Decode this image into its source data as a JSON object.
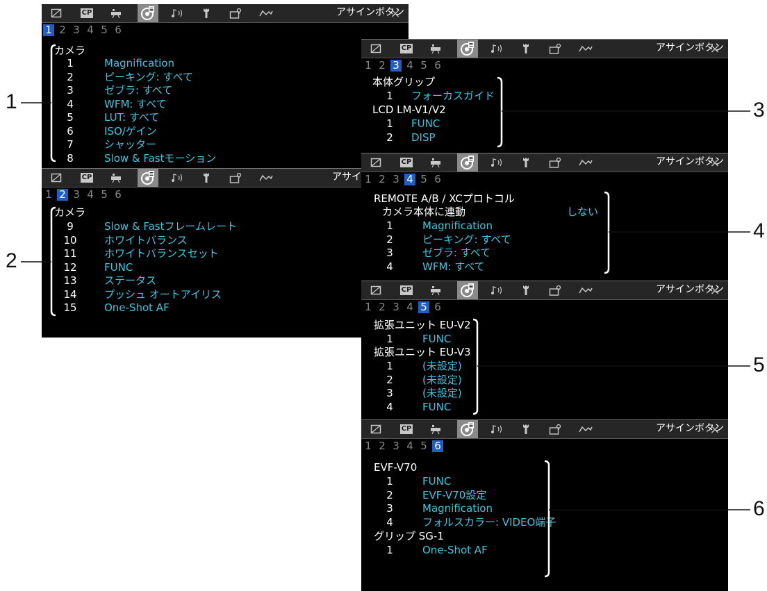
{
  "tabs": [
    {
      "icon": "photo-frame-icon"
    },
    {
      "icon": "cp-icon",
      "label": "CP"
    },
    {
      "icon": "camera-icon"
    },
    {
      "icon": "assign-button-icon"
    },
    {
      "icon": "audio-icon"
    },
    {
      "icon": "wrench-icon"
    },
    {
      "icon": "recording-media-icon"
    },
    {
      "icon": "signal-wave-icon"
    }
  ],
  "close_symbol": "×",
  "page_title": "アサインボタン",
  "page_numbers": [
    "1",
    "2",
    "3",
    "4",
    "5",
    "6"
  ],
  "panels": {
    "p1": {
      "active_page": "1",
      "header": "カメラ",
      "items": [
        {
          "num": "1",
          "value": "Magnification"
        },
        {
          "num": "2",
          "value": "ピーキング: すべて"
        },
        {
          "num": "3",
          "value": "ゼブラ: すべて"
        },
        {
          "num": "4",
          "value": "WFM: すべて"
        },
        {
          "num": "5",
          "value": "LUT: すべて"
        },
        {
          "num": "6",
          "value": "ISO/ゲイン"
        },
        {
          "num": "7",
          "value": "シャッター"
        },
        {
          "num": "8",
          "value": "Slow & Fastモーション"
        }
      ]
    },
    "p2": {
      "active_page": "2",
      "title_visible": "アサイ",
      "header": "カメラ",
      "items": [
        {
          "num": "9",
          "value": "Slow & Fastフレームレート"
        },
        {
          "num": "10",
          "value": "ホワイトバランス"
        },
        {
          "num": "11",
          "value": "ホワイトバランスセット"
        },
        {
          "num": "12",
          "value": "FUNC"
        },
        {
          "num": "13",
          "value": "ステータス"
        },
        {
          "num": "14",
          "value": "プッシュ オートアイリス"
        },
        {
          "num": "15",
          "value": "One-Shot AF"
        }
      ]
    },
    "p3": {
      "active_page": "3",
      "group1": "本体グリップ",
      "g1_items": [
        {
          "num": "1",
          "value": "フォーカスガイド"
        }
      ],
      "group2": "LCD LM-V1/V2",
      "g2_items": [
        {
          "num": "1",
          "value": "FUNC"
        },
        {
          "num": "2",
          "value": "DISP"
        }
      ]
    },
    "p4": {
      "active_page": "4",
      "group1": "REMOTE A/B / XCプロトコル",
      "link_label": "カメラ本体に連動",
      "link_value": "しない",
      "items": [
        {
          "num": "1",
          "value": "Magnification"
        },
        {
          "num": "2",
          "value": "ピーキング: すべて"
        },
        {
          "num": "3",
          "value": "ゼブラ: すべて"
        },
        {
          "num": "4",
          "value": "WFM: すべて"
        }
      ]
    },
    "p5": {
      "active_page": "5",
      "group1": "拡張ユニット EU-V2",
      "g1_items": [
        {
          "num": "1",
          "value": "FUNC"
        }
      ],
      "group2": "拡張ユニット EU-V3",
      "g2_items": [
        {
          "num": "1",
          "value": "(未設定)"
        },
        {
          "num": "2",
          "value": "(未設定)"
        },
        {
          "num": "3",
          "value": "(未設定)"
        },
        {
          "num": "4",
          "value": "FUNC"
        }
      ]
    },
    "p6": {
      "active_page": "6",
      "group1": "EVF-V70",
      "g1_items": [
        {
          "num": "1",
          "value": "FUNC"
        },
        {
          "num": "2",
          "value": "EVF-V70設定"
        },
        {
          "num": "3",
          "value": "Magnification"
        },
        {
          "num": "4",
          "value": "フォルスカラー: VIDEO端子"
        }
      ],
      "group2": "グリップ SG-1",
      "g2_items": [
        {
          "num": "1",
          "value": "One-Shot AF"
        }
      ]
    }
  },
  "callouts": [
    "1",
    "2",
    "3",
    "4",
    "5",
    "6"
  ]
}
